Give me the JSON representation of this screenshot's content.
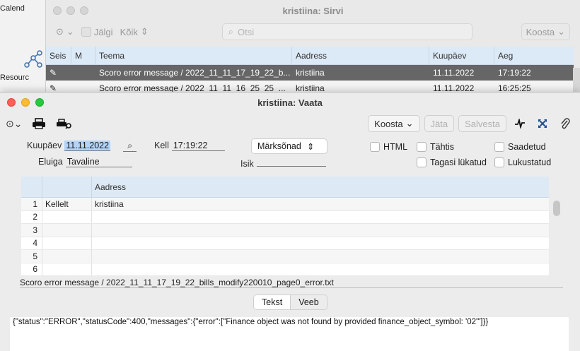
{
  "desktop": {
    "calendar_label": "Calend",
    "resources_label": "Resourc"
  },
  "back_window": {
    "title": "kristiina: Sirvi",
    "toolbar": {
      "filter_label": "Jälgi",
      "scope_label": "Kõik",
      "search_placeholder": "Otsi",
      "compose_label": "Koosta"
    },
    "columns": [
      "Seis",
      "M",
      "Teema",
      "Aadress",
      "Kuupäev",
      "Aeg"
    ],
    "rows": [
      {
        "subject": "Scoro error message / 2022_11_11_17_19_22_b...",
        "address": "kristiina",
        "date": "11.11.2022",
        "time": "17:19:22"
      },
      {
        "subject": "Scoro error message / 2022_11_11_16_25_25_...",
        "address": "kristiina",
        "date": "11.11.2022",
        "time": "16:25:25"
      }
    ]
  },
  "front_window": {
    "title": "kristiina: Vaata",
    "toolbar": {
      "compose_label": "Koosta",
      "discard_label": "Jäta",
      "save_label": "Salvesta"
    },
    "form": {
      "date_label": "Kuupäev",
      "date_value": "11.11.2022",
      "time_label": "Kell",
      "time_value": "17:19:22",
      "keywords_label": "Märksõnad",
      "html_label": "HTML",
      "important_label": "Tähtis",
      "sent_label": "Saadetud",
      "lifetime_label": "Eluiga",
      "lifetime_value": "Tavaline",
      "person_label": "Isik",
      "person_value": "",
      "recalled_label": "Tagasi lükatud",
      "locked_label": "Lukustatud"
    },
    "grid": {
      "header_address": "Aadress",
      "rows": [
        {
          "n": "1",
          "kind": "Kellelt",
          "address": "kristiina"
        },
        {
          "n": "2",
          "kind": "",
          "address": ""
        },
        {
          "n": "3",
          "kind": "",
          "address": ""
        },
        {
          "n": "4",
          "kind": "",
          "address": ""
        },
        {
          "n": "5",
          "kind": "",
          "address": ""
        },
        {
          "n": "6",
          "kind": "",
          "address": ""
        }
      ]
    },
    "subject": "Scoro error message / 2022_11_11_17_19_22_bills_modify220010_page0_error.txt",
    "tabs": {
      "text_label": "Tekst",
      "web_label": "Veeb"
    },
    "body": "{\"status\":\"ERROR\",\"statusCode\":400,\"messages\":{\"error\":[\"Finance object was not found by provided finance_object_symbol: '02'\"]}}"
  }
}
